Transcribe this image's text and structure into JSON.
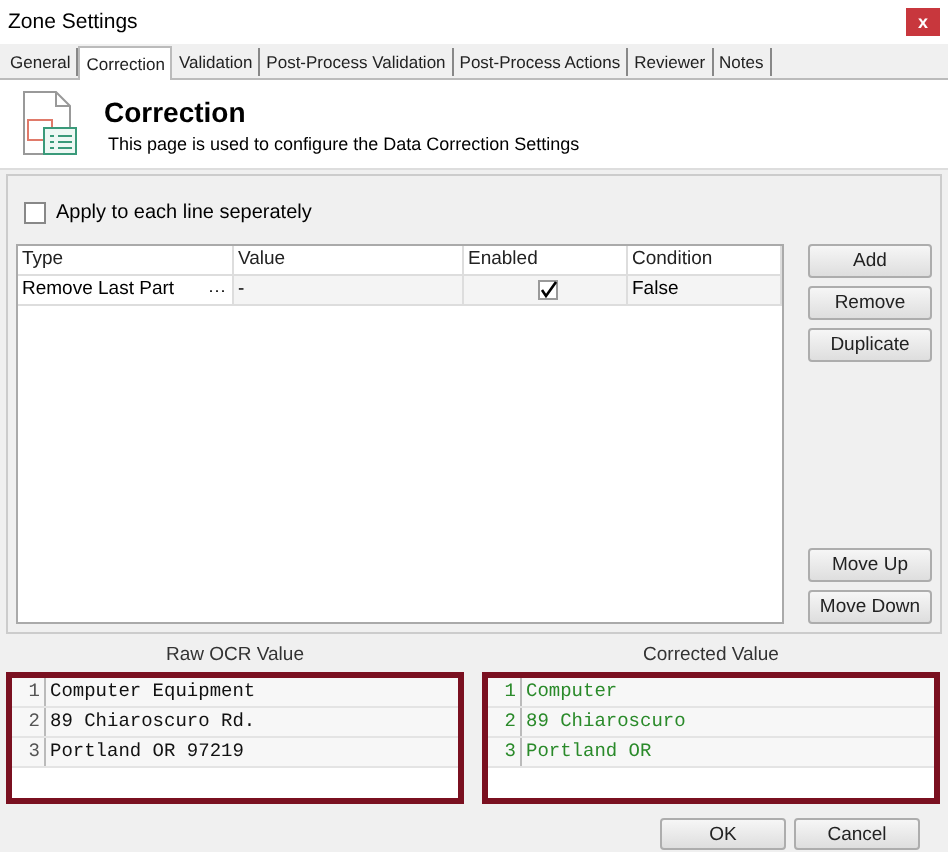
{
  "window": {
    "title": "Zone Settings",
    "close": "x"
  },
  "tabs": [
    {
      "label": "General",
      "selected": false
    },
    {
      "label": "Correction",
      "selected": true
    },
    {
      "label": "Validation",
      "selected": false
    },
    {
      "label": "Post-Process Validation",
      "selected": false
    },
    {
      "label": "Post-Process Actions",
      "selected": false
    },
    {
      "label": "Reviewer",
      "selected": false
    },
    {
      "label": "Notes",
      "selected": false
    }
  ],
  "header": {
    "title": "Correction",
    "description": "This page is used to configure the Data Correction Settings"
  },
  "apply_each_line": {
    "label": "Apply to each line seperately",
    "checked": false
  },
  "table": {
    "columns": [
      "Type",
      "Value",
      "Enabled",
      "Condition"
    ],
    "rows": [
      {
        "type": "Remove Last Part",
        "browse": "···",
        "value": "-",
        "enabled": true,
        "condition": "False"
      }
    ]
  },
  "side_buttons_top": [
    "Add",
    "Remove",
    "Duplicate"
  ],
  "side_buttons_bottom": [
    "Move Up",
    "Move Down"
  ],
  "panes": [
    {
      "label": "Raw OCR Value",
      "kind": "raw",
      "lines": [
        {
          "number": "1",
          "text": "Computer Equipment"
        },
        {
          "number": "2",
          "text": "89 Chiaroscuro Rd."
        },
        {
          "number": "3",
          "text": "Portland OR 97219"
        }
      ]
    },
    {
      "label": "Corrected Value",
      "kind": "corrected",
      "lines": [
        {
          "number": "1",
          "text": "Computer"
        },
        {
          "number": "2",
          "text": "89 Chiaroscuro"
        },
        {
          "number": "3",
          "text": "Portland OR"
        }
      ]
    }
  ],
  "footer_buttons": [
    "OK",
    "Cancel"
  ]
}
